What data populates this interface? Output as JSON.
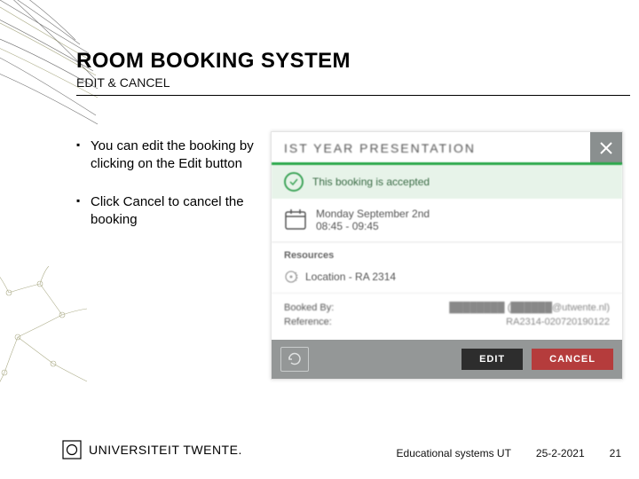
{
  "title": "ROOM BOOKING SYSTEM",
  "subtitle": "EDIT & CANCEL",
  "bullets": [
    "You can edit the booking by clicking on the Edit button",
    "Click Cancel to cancel the booking"
  ],
  "modal": {
    "title": "IST YEAR PRESENTATION",
    "status": "This booking is accepted",
    "date_line1": "Monday September 2nd",
    "date_line2": "08:45 - 09:45",
    "resources_label": "Resources",
    "location": "Location - RA 2314",
    "booked_by_label": "Booked By:",
    "booked_by_value": "████████  (██████@utwente.nl)",
    "reference_label": "Reference:",
    "reference_value": "RA2314-020720190122",
    "edit_label": "EDIT",
    "cancel_label": "CANCEL"
  },
  "footer": {
    "brand": "UNIVERSITEIT TWENTE.",
    "meta1": "Educational systems UT",
    "date": "25-2-2021",
    "page": "21"
  }
}
